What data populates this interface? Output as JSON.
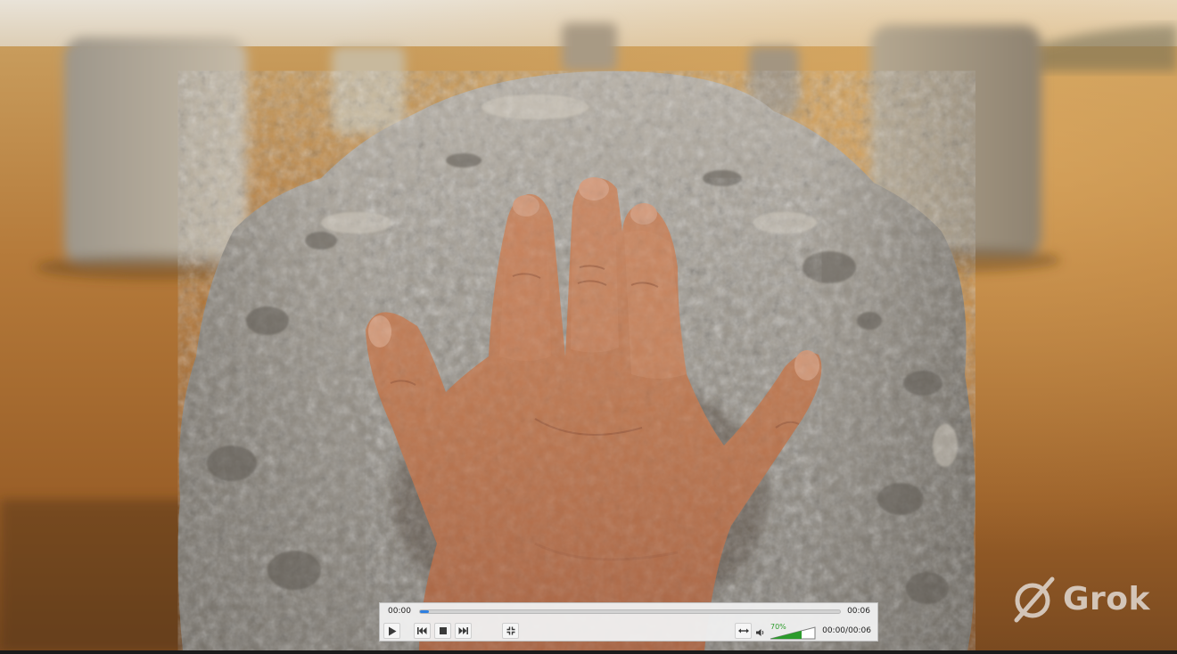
{
  "watermark": {
    "text": "Grok",
    "icon": "grok-logo-icon"
  },
  "player": {
    "current_time": "00:00",
    "end_time": "00:06",
    "elapsed_total": "00:00/00:06",
    "progress": 0.02,
    "volume_label": "70%",
    "volume": 0.7,
    "accent_color": "#2f7fe0",
    "volume_color": "#2c9b2c",
    "buttons": [
      "play-icon",
      "previous-icon",
      "stop-icon",
      "next-icon",
      "fullscreen-icon",
      "stretch-icon",
      "speaker-icon"
    ]
  }
}
